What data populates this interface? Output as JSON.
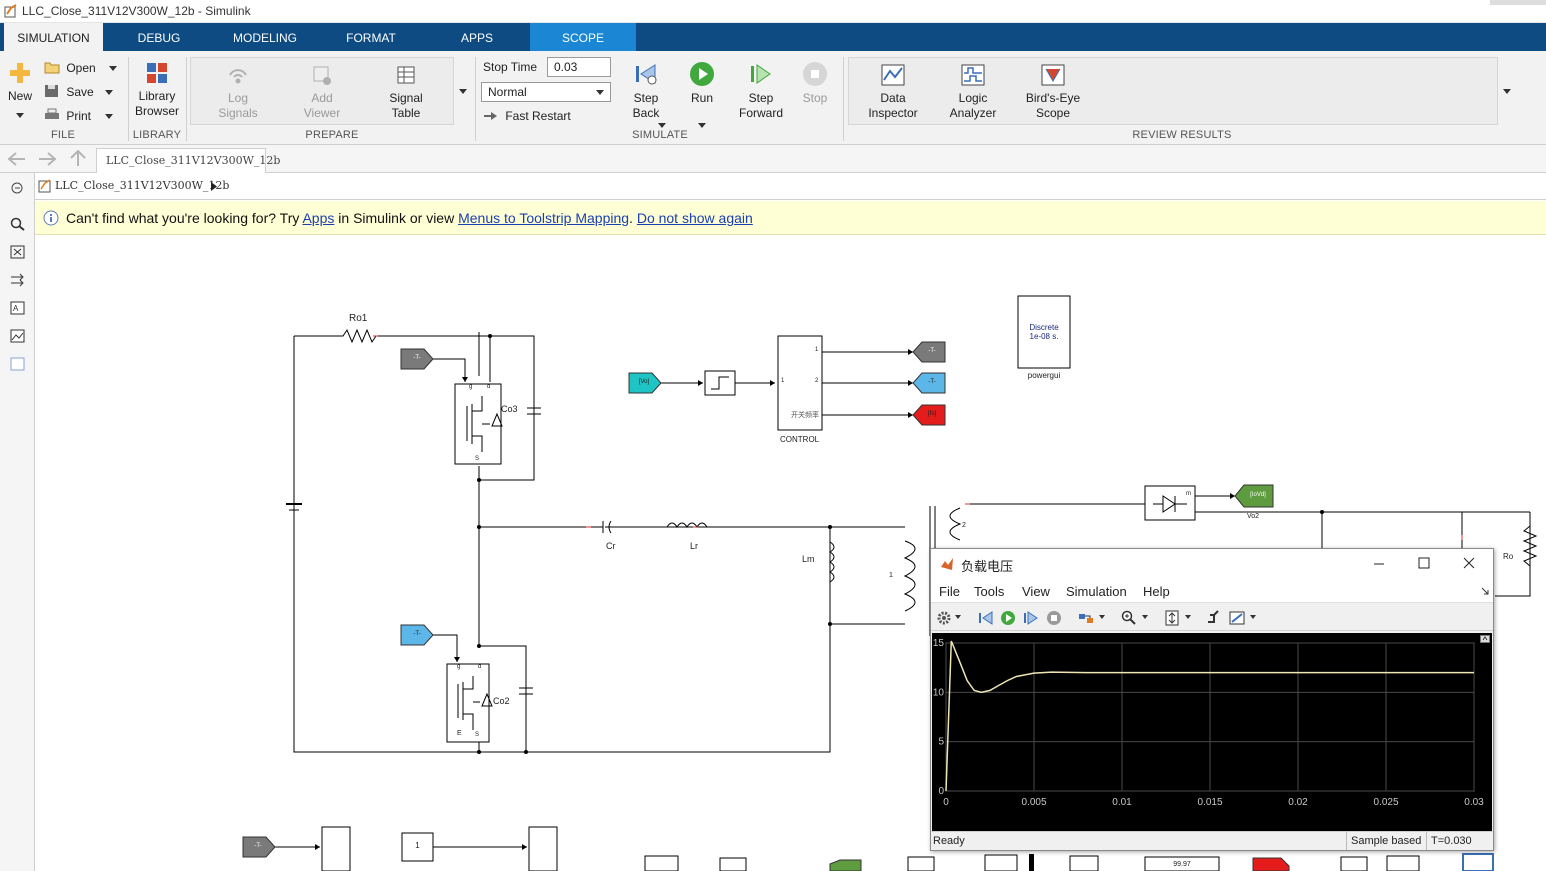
{
  "window": {
    "title": "LLC_Close_311V12V300W_12b - Simulink"
  },
  "ribbon": {
    "tabs": [
      "SIMULATION",
      "DEBUG",
      "MODELING",
      "FORMAT",
      "APPS",
      "SCOPE"
    ],
    "file": {
      "new": "New",
      "open": "Open",
      "save": "Save",
      "print": "Print",
      "group": "FILE"
    },
    "library": {
      "browser_line1": "Library",
      "browser_line2": "Browser",
      "group": "LIBRARY"
    },
    "prepare": {
      "log_line1": "Log",
      "log_line2": "Signals",
      "viewer_line1": "Add",
      "viewer_line2": "Viewer",
      "table_line1": "Signal",
      "table_line2": "Table",
      "group": "PREPARE"
    },
    "simulate": {
      "stop_time_label": "Stop Time",
      "stop_time_value": "0.03",
      "mode": "Normal",
      "fast_restart": "Fast Restart",
      "step_back_line1": "Step",
      "step_back_line2": "Back",
      "run": "Run",
      "step_fwd_line1": "Step",
      "step_fwd_line2": "Forward",
      "stop": "Stop",
      "group": "SIMULATE"
    },
    "review": {
      "data_line1": "Data",
      "data_line2": "Inspector",
      "logic_line1": "Logic",
      "logic_line2": "Analyzer",
      "birds_line1": "Bird's-Eye",
      "birds_line2": "Scope",
      "group": "REVIEW RESULTS"
    }
  },
  "nav": {
    "doc_tab": "LLC_Close_311V12V300W_12b"
  },
  "breadcrumb": {
    "model": "LLC_Close_311V12V300W_12b"
  },
  "banner": {
    "prefix": "Can't find what you're looking for? Try ",
    "apps_link": "Apps",
    "middle": " in Simulink or view ",
    "menus_link": "Menus to Toolstrip Mapping",
    "dot": ".",
    "dismiss_link": "Do not show again"
  },
  "diagram": {
    "ro1": "Ro1",
    "co3": "Co3",
    "co2": "Co2",
    "cr": "Cr",
    "lr": "Lr",
    "lm": "Lm",
    "ro": "Ro",
    "goto_t": "-T-",
    "from_vo": "[Vo]",
    "goto_fs": "[fs]",
    "goto_iovd": "[IoVd]",
    "vo2": "Vo2",
    "control": "CONTROL",
    "control_port": "开关频率",
    "port_1": "1",
    "port_2": "2",
    "port_m": "m",
    "powergui_line1": "Discrete",
    "powergui_line2": "1e-08 s.",
    "powergui": "powergui",
    "const_1": "1",
    "display_value": "99.97",
    "gate_g": "g",
    "drain_d": "d",
    "source_s": "S",
    "emitter_e": "E",
    "winding_1": "1",
    "winding_2": "2"
  },
  "scope": {
    "title": "负载电压",
    "menu": [
      "File",
      "Tools",
      "View",
      "Simulation",
      "Help"
    ],
    "status": "Ready",
    "sample": "Sample based",
    "time": "T=0.030"
  },
  "chart_data": {
    "type": "line",
    "title": "",
    "xlabel": "",
    "ylabel": "",
    "xlim": [
      0,
      0.03
    ],
    "ylim": [
      0,
      15
    ],
    "x_ticks": [
      "0",
      "0.005",
      "0.01",
      "0.015",
      "0.02",
      "0.025",
      "0.03"
    ],
    "y_ticks": [
      "0",
      "5",
      "10",
      "15"
    ],
    "grid": true,
    "series": [
      {
        "x": [
          0,
          0.0003,
          0.0008,
          0.0012,
          0.0016,
          0.002,
          0.0025,
          0.003,
          0.0035,
          0.004,
          0.005,
          0.006,
          0.008,
          0.01,
          0.015,
          0.02,
          0.025,
          0.03
        ],
        "y": [
          0,
          15.2,
          13.0,
          11.2,
          10.2,
          10.0,
          10.2,
          10.7,
          11.2,
          11.6,
          11.95,
          12.05,
          12.0,
          12.0,
          12.0,
          12.0,
          12.0,
          12.0
        ]
      }
    ],
    "colors": {
      "line": "#f0e6b4",
      "background": "#000000",
      "grid": "#4a4a4a"
    }
  }
}
